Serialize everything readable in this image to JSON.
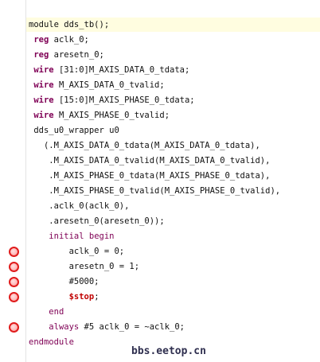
{
  "editor": {
    "highlight_color": "#fffde0",
    "keyword_color": "#7f0055",
    "system_task_color": "#c00000",
    "breakpoint_color": "#e01c1c",
    "lines": [
      {
        "indent": "",
        "tokens": [
          {
            "t": "module dds_tb();",
            "c": ""
          }
        ]
      },
      {
        "indent": " ",
        "tokens": [
          {
            "t": "reg",
            "c": "kw"
          },
          {
            "t": " aclk_0;",
            "c": ""
          }
        ]
      },
      {
        "indent": " ",
        "tokens": [
          {
            "t": "reg",
            "c": "kw"
          },
          {
            "t": " aresetn_0;",
            "c": ""
          }
        ]
      },
      {
        "indent": " ",
        "tokens": [
          {
            "t": "wire",
            "c": "kw"
          },
          {
            "t": " [31:0]M_AXIS_DATA_0_tdata;",
            "c": ""
          }
        ]
      },
      {
        "indent": " ",
        "tokens": [
          {
            "t": "wire",
            "c": "kw"
          },
          {
            "t": " M_AXIS_DATA_0_tvalid;",
            "c": ""
          }
        ]
      },
      {
        "indent": " ",
        "tokens": [
          {
            "t": "wire",
            "c": "kw"
          },
          {
            "t": " [15:0]M_AXIS_PHASE_0_tdata;",
            "c": ""
          }
        ]
      },
      {
        "indent": " ",
        "tokens": [
          {
            "t": "wire",
            "c": "kw"
          },
          {
            "t": " M_AXIS_PHASE_0_tvalid;",
            "c": ""
          }
        ]
      },
      {
        "indent": " ",
        "tokens": [
          {
            "t": "dds_u0_wrapper u0",
            "c": ""
          }
        ]
      },
      {
        "indent": "   ",
        "tokens": [
          {
            "t": "(.M_AXIS_DATA_0_tdata(M_AXIS_DATA_0_tdata),",
            "c": ""
          }
        ]
      },
      {
        "indent": "    ",
        "tokens": [
          {
            "t": ".M_AXIS_DATA_0_tvalid(M_AXIS_DATA_0_tvalid),",
            "c": ""
          }
        ]
      },
      {
        "indent": "    ",
        "tokens": [
          {
            "t": ".M_AXIS_PHASE_0_tdata(M_AXIS_PHASE_0_tdata),",
            "c": ""
          }
        ]
      },
      {
        "indent": "    ",
        "tokens": [
          {
            "t": ".M_AXIS_PHASE_0_tvalid(M_AXIS_PHASE_0_tvalid),",
            "c": ""
          }
        ]
      },
      {
        "indent": "    ",
        "tokens": [
          {
            "t": ".aclk_0(aclk_0),",
            "c": ""
          }
        ]
      },
      {
        "indent": "    ",
        "tokens": [
          {
            "t": ".aresetn_0(aresetn_0));",
            "c": ""
          }
        ]
      },
      {
        "indent": "    ",
        "tokens": [
          {
            "t": "initial begin",
            "c": "kw2"
          }
        ]
      },
      {
        "indent": "        ",
        "tokens": [
          {
            "t": "aclk_0 = 0;",
            "c": ""
          }
        ]
      },
      {
        "indent": "        ",
        "tokens": [
          {
            "t": "aresetn_0 = 1;",
            "c": ""
          }
        ]
      },
      {
        "indent": "        ",
        "tokens": [
          {
            "t": "#5000;",
            "c": ""
          }
        ]
      },
      {
        "indent": "        ",
        "tokens": [
          {
            "t": "$stop",
            "c": "sys"
          },
          {
            "t": ";",
            "c": ""
          }
        ]
      },
      {
        "indent": "    ",
        "tokens": [
          {
            "t": "end",
            "c": "kw2"
          }
        ]
      },
      {
        "indent": "    ",
        "tokens": [
          {
            "t": "always",
            "c": "kw2"
          },
          {
            "t": " #5 aclk_0 = ~aclk_0;",
            "c": ""
          }
        ]
      },
      {
        "indent": "",
        "tokens": [
          {
            "t": "endmodule",
            "c": "kw2"
          }
        ]
      }
    ],
    "breakpoint_lines": [
      15,
      16,
      17,
      18,
      20
    ]
  },
  "watermark": "bbs.eetop.cn"
}
